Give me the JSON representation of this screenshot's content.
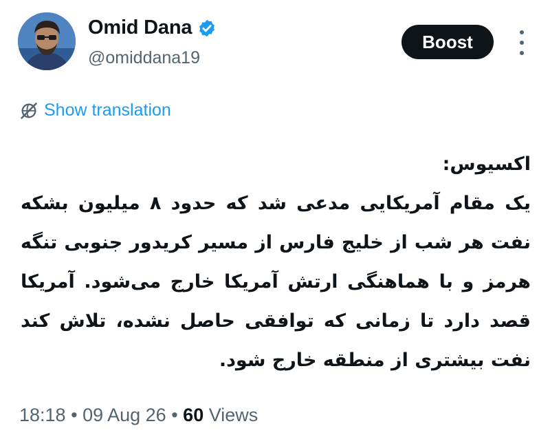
{
  "author": {
    "display_name": "Omid Dana",
    "handle": "@omiddana19",
    "verified": true,
    "avatar_icon": "profile-photo"
  },
  "actions": {
    "boost_label": "Boost",
    "more_icon": "vertical-ellipsis-icon"
  },
  "translation": {
    "icon": "globe-slash-icon",
    "label": "Show translation"
  },
  "tweet": {
    "lines": [
      "اکسیوس:",
      "یک مقام آمریکایی مدعی شد که حدود ۸ میلیون بشکه نفت هر شب از خلیج فارس از مسیر کریدور جنوبی تنگه هرمز و با هماهنگی ارتش آمریکا خارج می‌شود. آمریکا قصد دارد تا زمانی که توافقی حاصل نشده، تلاش کند نفت بیشتری از منطقه خارج شود."
    ]
  },
  "meta": {
    "time": "18:18",
    "separator": "•",
    "date": "09 Aug 26",
    "views_count": "60",
    "views_label": "Views"
  },
  "colors": {
    "link": "#1d9bf0",
    "secondary_text": "#536471",
    "primary_text": "#0f1419",
    "verified_badge": "#1d9bf0",
    "button_bg": "#0f1419"
  }
}
